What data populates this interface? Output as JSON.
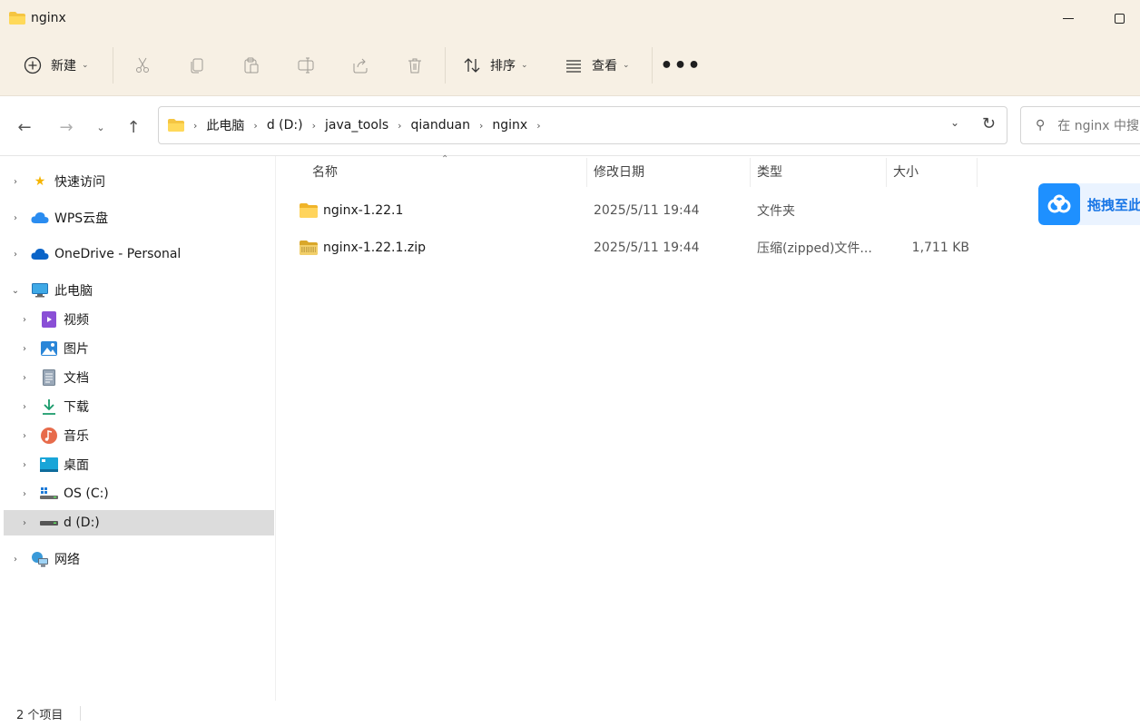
{
  "window": {
    "title": "nginx"
  },
  "toolbar": {
    "new_label": "新建",
    "sort_label": "排序",
    "view_label": "查看",
    "more_label": "•••",
    "icons": [
      "cut-icon",
      "copy-icon",
      "paste-icon",
      "rename-icon",
      "share-icon",
      "delete-icon"
    ]
  },
  "address": {
    "crumbs": [
      "此电脑",
      "d (D:)",
      "java_tools",
      "qianduan",
      "nginx"
    ],
    "search_placeholder": "在 nginx 中搜"
  },
  "sidebar": {
    "items": [
      {
        "label": "快速访问",
        "icon": "star-icon"
      },
      {
        "label": "WPS云盘",
        "icon": "wps-cloud-icon"
      },
      {
        "label": "OneDrive - Personal",
        "icon": "onedrive-icon"
      },
      {
        "label": "此电脑",
        "icon": "this-pc-icon",
        "expanded": true
      },
      {
        "label": "视频",
        "icon": "video-icon"
      },
      {
        "label": "图片",
        "icon": "pictures-icon"
      },
      {
        "label": "文档",
        "icon": "documents-icon"
      },
      {
        "label": "下载",
        "icon": "download-icon"
      },
      {
        "label": "音乐",
        "icon": "music-icon"
      },
      {
        "label": "桌面",
        "icon": "desktop-icon"
      },
      {
        "label": "OS (C:)",
        "icon": "drive-c-icon"
      },
      {
        "label": "d (D:)",
        "icon": "drive-d-icon",
        "selected": true
      },
      {
        "label": "网络",
        "icon": "network-icon"
      }
    ]
  },
  "columns": {
    "name": "名称",
    "modified": "修改日期",
    "type": "类型",
    "size": "大小"
  },
  "files": [
    {
      "name": "nginx-1.22.1",
      "modified": "2025/5/11 19:44",
      "type": "文件夹",
      "size": "",
      "icon": "folder-icon"
    },
    {
      "name": "nginx-1.22.1.zip",
      "modified": "2025/5/11 19:44",
      "type": "压缩(zipped)文件...",
      "size": "1,711 KB",
      "icon": "zip-folder-icon"
    }
  ],
  "wps_float": {
    "label": "拖拽至此"
  },
  "status": {
    "item_count": "2 个项目"
  },
  "colors": {
    "chrome": "#f7f0e4",
    "selected": "#dcdcdc",
    "accent": "#1e90ff"
  }
}
